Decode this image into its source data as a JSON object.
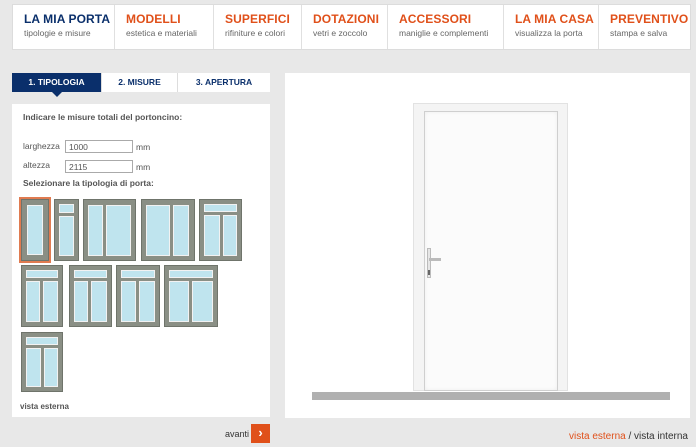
{
  "nav": [
    {
      "title": "LA MIA PORTA",
      "subtitle": "tipologie e misure"
    },
    {
      "title": "MODELLI",
      "subtitle": "estetica e materiali"
    },
    {
      "title": "SUPERFICI",
      "subtitle": "rifiniture e colori"
    },
    {
      "title": "DOTAZIONI",
      "subtitle": "vetri e zoccolo"
    },
    {
      "title": "ACCESSORI",
      "subtitle": "maniglie e complementi"
    },
    {
      "title": "LA MIA CASA",
      "subtitle": "visualizza la porta"
    },
    {
      "title": "PREVENTIVO",
      "subtitle": "stampa e salva"
    }
  ],
  "tabs": [
    "1. TIPOLOGIA",
    "2. MISURE",
    "3. APERTURA"
  ],
  "form": {
    "instruction": "Indicare le misure totali del portoncino:",
    "width_label": "larghezza",
    "width_value": "1000",
    "height_label": "altezza",
    "height_value": "2115",
    "unit": "mm",
    "select_label": "Selezionare la tipologia di porta:",
    "view_label": "vista esterna"
  },
  "door_types_count": 10,
  "next_label": "avanti",
  "next_icon": "chevron-right-icon",
  "view_toggle": {
    "external": "vista esterna",
    "separator": " / ",
    "internal": "vista interna"
  },
  "colors": {
    "accent": "#e0501a",
    "brand": "#0a2f6b"
  }
}
